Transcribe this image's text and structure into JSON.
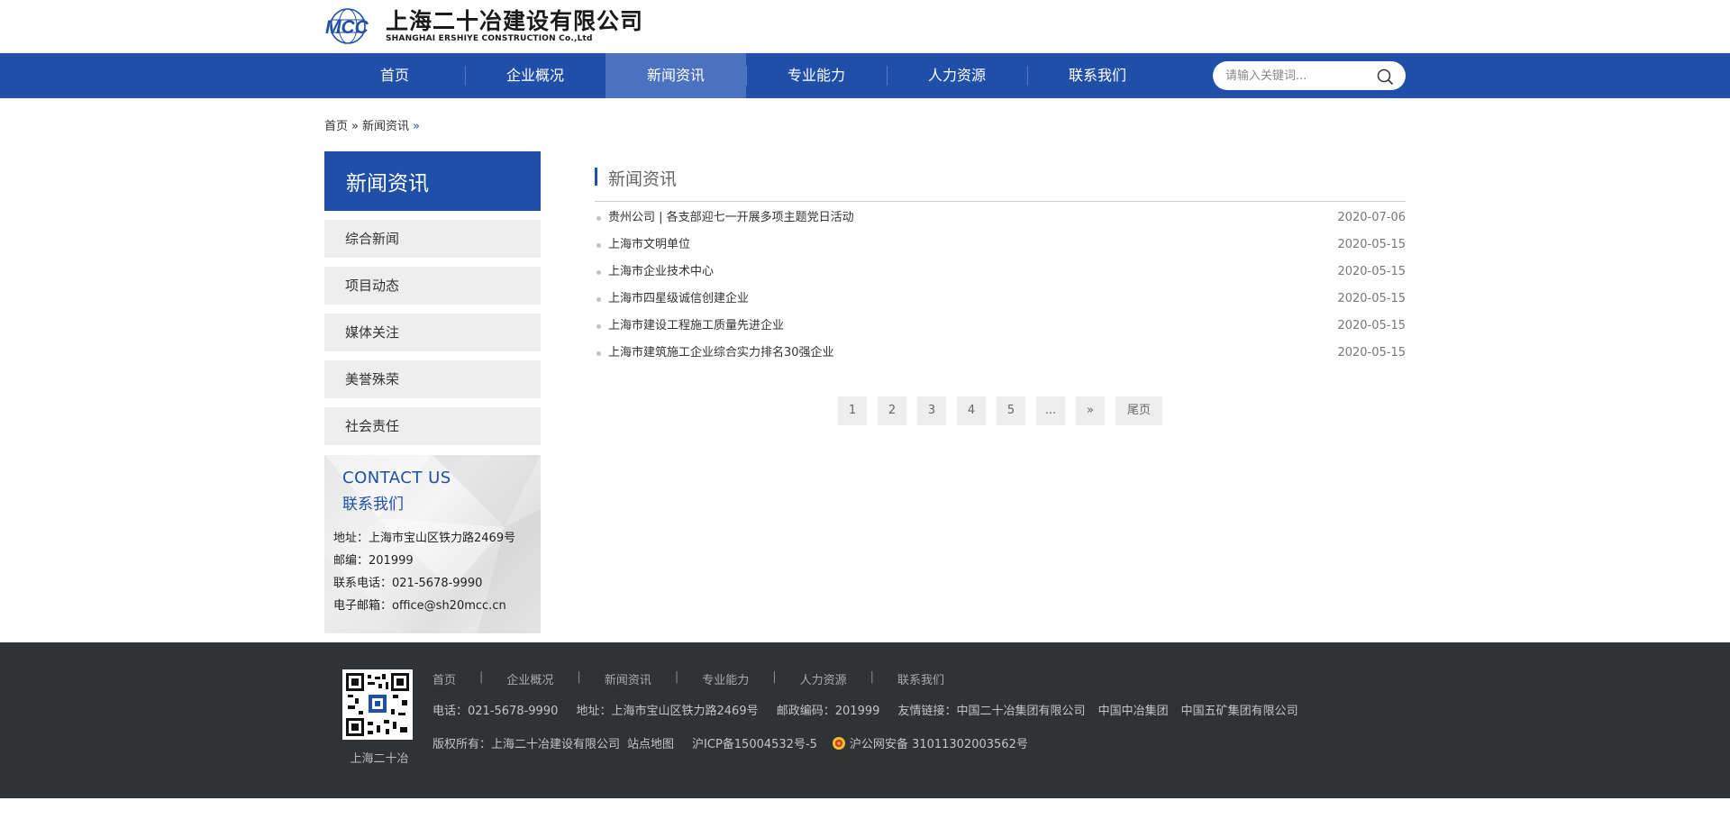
{
  "header": {
    "logo_mark": "MCC",
    "logo_cn": "上海二十冶建设有限公司",
    "logo_en": "SHANGHAI ERSHIYE CONSTRUCTION Co.,Ltd"
  },
  "nav": {
    "items": [
      {
        "label": "首页"
      },
      {
        "label": "企业概况"
      },
      {
        "label": "新闻资讯",
        "active": true
      },
      {
        "label": "专业能力"
      },
      {
        "label": "人力资源"
      },
      {
        "label": "联系我们"
      }
    ],
    "search_placeholder": "请输入关键词..."
  },
  "breadcrumb": {
    "home": "首页",
    "sep": "»",
    "current": "新闻资讯",
    "trailing": "»"
  },
  "sidebar": {
    "title": "新闻资讯",
    "items": [
      {
        "label": "综合新闻"
      },
      {
        "label": "项目动态"
      },
      {
        "label": "媒体关注"
      },
      {
        "label": "美誉殊荣"
      },
      {
        "label": "社会责任"
      }
    ],
    "contact": {
      "title_en": "CONTACT US",
      "title_cn": "联系我们",
      "address": "地址：上海市宝山区铁力路2469号",
      "postcode": "邮编：201999",
      "phone": "联系电话：021-5678-9990",
      "email": "电子邮箱：office@sh20mcc.cn"
    }
  },
  "main": {
    "title": "新闻资讯",
    "news": [
      {
        "title": "贵州公司 | 各支部迎七一开展多项主题党日活动",
        "date": "2020-07-06"
      },
      {
        "title": "上海市文明单位",
        "date": "2020-05-15"
      },
      {
        "title": "上海市企业技术中心",
        "date": "2020-05-15"
      },
      {
        "title": "上海市四星级诚信创建企业",
        "date": "2020-05-15"
      },
      {
        "title": "上海市建设工程施工质量先进企业",
        "date": "2020-05-15"
      },
      {
        "title": "上海市建筑施工企业综合实力排名30强企业",
        "date": "2020-05-15"
      }
    ],
    "pagination": [
      "1",
      "2",
      "3",
      "4",
      "5",
      "...",
      "»",
      "尾页"
    ]
  },
  "footer": {
    "qr_label": "上海二十冶",
    "nav": [
      "首页",
      "企业概况",
      "新闻资讯",
      "专业能力",
      "人力资源",
      "联系我们"
    ],
    "nav_divider": "|",
    "phone": "电话：021-5678-9990",
    "address": "地址：上海市宝山区铁力路2469号",
    "postcode": "邮政编码：201999",
    "links_label": "友情链接：",
    "links": [
      "中国二十冶集团有限公司",
      "中国中冶集团",
      "中国五矿集团有限公司"
    ],
    "copyright": "版权所有：上海二十冶建设有限公司",
    "sitemap": "站点地图",
    "icp": "沪ICP备15004532号-5",
    "police": "沪公网安备 31011302003562号"
  },
  "colors": {
    "primary": "#1f4fa8",
    "nav_active": "#4a72c0",
    "footer_bg": "#2f3336",
    "side_item_bg": "#eeeeee"
  }
}
